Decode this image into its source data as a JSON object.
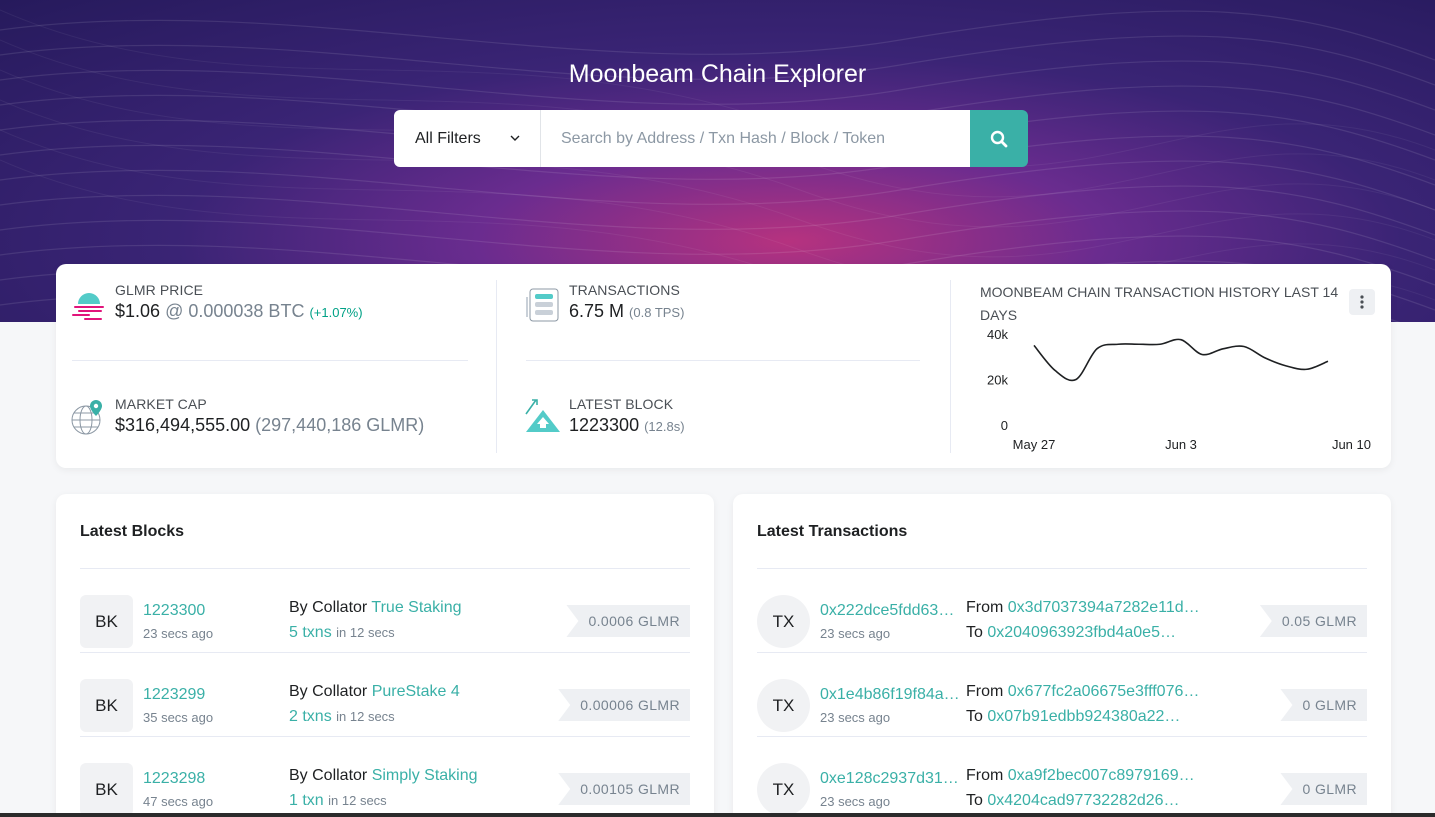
{
  "header": {
    "title": "Moonbeam Chain Explorer",
    "filter_label": "All Filters",
    "search_placeholder": "Search by Address / Txn Hash / Block / Token"
  },
  "stats": {
    "price": {
      "label": "GLMR PRICE",
      "usd": "$1.06",
      "at": "@",
      "btc": "0.000038 BTC",
      "change": "(+1.07%)"
    },
    "market_cap": {
      "label": "MARKET CAP",
      "usd": "$316,494,555.00",
      "glmr": "(297,440,186 GLMR)"
    },
    "transactions": {
      "label": "TRANSACTIONS",
      "value": "6.75 M",
      "tps": "(0.8 TPS)"
    },
    "latest_block": {
      "label": "LATEST BLOCK",
      "value": "1223300",
      "time": "(12.8s)"
    }
  },
  "chart_data": {
    "type": "line",
    "title": "MOONBEAM CHAIN TRANSACTION HISTORY LAST 14 DAYS",
    "x": [
      "May 27",
      "May 28",
      "May 29",
      "May 30",
      "May 31",
      "Jun 1",
      "Jun 2",
      "Jun 3",
      "Jun 4",
      "Jun 5",
      "Jun 6",
      "Jun 7",
      "Jun 8",
      "Jun 9",
      "Jun 10"
    ],
    "values": [
      35000,
      24000,
      20000,
      33500,
      35500,
      35500,
      35500,
      37500,
      31000,
      33500,
      34500,
      29500,
      26000,
      24500,
      28000
    ],
    "x_ticks": [
      "May 27",
      "Jun 3",
      "Jun 10"
    ],
    "y_ticks": [
      "40k",
      "20k",
      "0"
    ],
    "ylim": [
      0,
      40000
    ],
    "color": "#1e2022"
  },
  "latest_blocks": {
    "title": "Latest Blocks",
    "rows": [
      {
        "badge": "BK",
        "block": "1223300",
        "age": "23 secs ago",
        "by": "By Collator",
        "collator": "True Staking",
        "txns": "5 txns",
        "in": "in 12 secs",
        "reward": "0.0006 GLMR"
      },
      {
        "badge": "BK",
        "block": "1223299",
        "age": "35 secs ago",
        "by": "By Collator",
        "collator": "PureStake 4",
        "txns": "2 txns",
        "in": "in 12 secs",
        "reward": "0.00006 GLMR"
      },
      {
        "badge": "BK",
        "block": "1223298",
        "age": "47 secs ago",
        "by": "By Collator",
        "collator": "Simply Staking",
        "txns": "1 txn",
        "in": "in 12 secs",
        "reward": "0.00105 GLMR"
      }
    ]
  },
  "latest_transactions": {
    "title": "Latest Transactions",
    "rows": [
      {
        "badge": "TX",
        "hash": "0x222dce5fdd63…",
        "age": "23 secs ago",
        "from_label": "From",
        "from": "0x3d7037394a7282e11d…",
        "to_label": "To",
        "to": "0x2040963923fbd4a0e5…",
        "value": "0.05 GLMR"
      },
      {
        "badge": "TX",
        "hash": "0x1e4b86f19f84a…",
        "age": "23 secs ago",
        "from_label": "From",
        "from": "0x677fc2a06675e3fff076…",
        "to_label": "To",
        "to": "0x07b91edbb924380a22…",
        "value": "0 GLMR"
      },
      {
        "badge": "TX",
        "hash": "0xe128c2937d31…",
        "age": "23 secs ago",
        "from_label": "From",
        "from": "0xa9f2bec007c8979169…",
        "to_label": "To",
        "to": "0x4204cad97732282d26…",
        "value": "0 GLMR"
      }
    ]
  },
  "colors": {
    "accent": "#3ab0a7",
    "hero_dark": "#261a5c",
    "hero_pink": "#b6327f"
  },
  "icons": {
    "price": "glmr-logo-icon",
    "market_cap": "globe-icon",
    "transactions": "server-icon",
    "latest_block": "mountain-icon",
    "search": "search-icon",
    "menu": "more-vertical-icon"
  }
}
